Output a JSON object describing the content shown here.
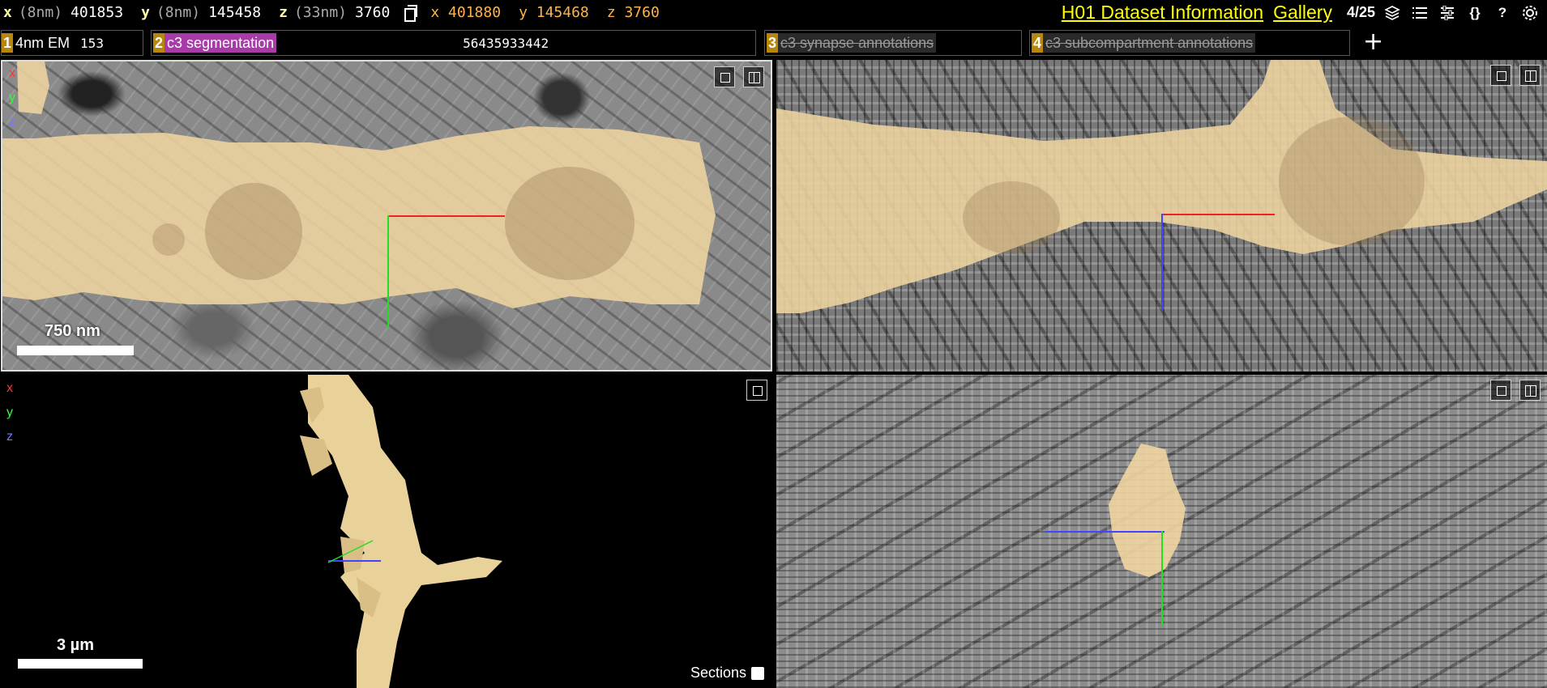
{
  "top": {
    "pos": {
      "x": {
        "axis": "x",
        "unit": "(8nm)",
        "value": "401853"
      },
      "y": {
        "axis": "y",
        "unit": "(8nm)",
        "value": "145458"
      },
      "z": {
        "axis": "z",
        "unit": "(33nm)",
        "value": "3760"
      }
    },
    "mouse": {
      "x": "x 401880",
      "y": "y 145468",
      "z": "z 3760"
    },
    "links": {
      "info": "H01 Dataset Information",
      "gallery": "Gallery"
    },
    "layer_count": "4/25",
    "icons": {
      "layers": "layers-icon",
      "list": "list-icon",
      "settings_sliders": "sliders-icon",
      "json": "{}",
      "help": "?",
      "gear": "gear-icon"
    }
  },
  "layers": [
    {
      "num": "1",
      "name": "4nm EM",
      "value": "153"
    },
    {
      "num": "2",
      "name": "c3 segmentation",
      "value": "56435933442"
    },
    {
      "num": "3",
      "name": "c3 synapse annotations"
    },
    {
      "num": "4",
      "name": "c3 subcompartment annotations"
    }
  ],
  "add_layer": "+",
  "panels": {
    "xy": {
      "scale": "750 nm"
    },
    "view3d": {
      "scale": "3 µm",
      "sections_label": "Sections"
    },
    "legend": {
      "x": "x",
      "y": "y",
      "z": "z"
    }
  },
  "colors": {
    "segment": "#efd5a0",
    "accent_yellow": "#ffff00",
    "layer_num_bg": "#b8860b",
    "seg_layer_bg": "#a73ba7"
  }
}
